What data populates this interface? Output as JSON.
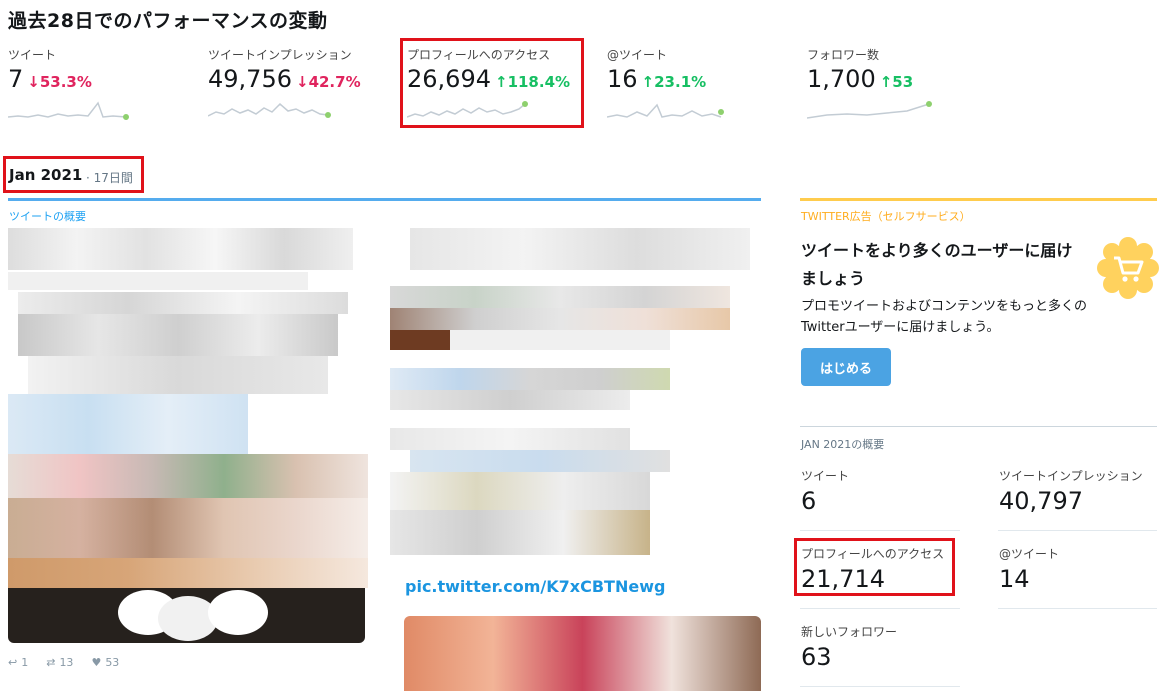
{
  "page": {
    "title": "過去28日でのパフォーマンスの変動"
  },
  "metrics": [
    {
      "label": "ツイート",
      "value": "7",
      "delta": "53.3%",
      "direction": "down",
      "arrow": "↓"
    },
    {
      "label": "ツイートインプレッション",
      "value": "49,756",
      "delta": "42.7%",
      "direction": "down",
      "arrow": "↓"
    },
    {
      "label": "プロフィールへのアクセス",
      "value": "26,694",
      "delta": "118.4%",
      "direction": "up",
      "arrow": "↑"
    },
    {
      "label": "@ツイート",
      "value": "16",
      "delta": "23.1%",
      "direction": "up",
      "arrow": "↑"
    },
    {
      "label": "フォロワー数",
      "value": "1,700",
      "delta": "53",
      "direction": "up",
      "arrow": "↑"
    }
  ],
  "month": {
    "title": "Jan 2021",
    "sub": "17日間"
  },
  "tweets_section": {
    "label": "ツイートの概要",
    "link_fragment": "pic.twitter.com/K7xCBTNewg",
    "actions": {
      "reply": "1",
      "retweet": "13",
      "like": "53"
    }
  },
  "ad": {
    "label": "TWITTER広告（セルフサービス）",
    "title": "ツイートをより多くのユーザーに届けましょう",
    "body": "プロモツイートおよびコンテンツをもっと多くのTwitterユーザーに届けましょう。",
    "button": "はじめる",
    "icon": "cart-icon"
  },
  "summary": {
    "title": "JAN 2021の概要",
    "items": [
      {
        "label": "ツイート",
        "value": "6"
      },
      {
        "label": "ツイートインプレッション",
        "value": "40,797"
      },
      {
        "label": "プロフィールへのアクセス",
        "value": "21,714"
      },
      {
        "label": "@ツイート",
        "value": "14"
      },
      {
        "label": "新しいフォロワー",
        "value": "63"
      }
    ]
  },
  "colors": {
    "up": "#17bf63",
    "down": "#e0245e",
    "accent": "#1da1f2",
    "highlight": "#e0121a",
    "ad": "#ffad1f"
  }
}
